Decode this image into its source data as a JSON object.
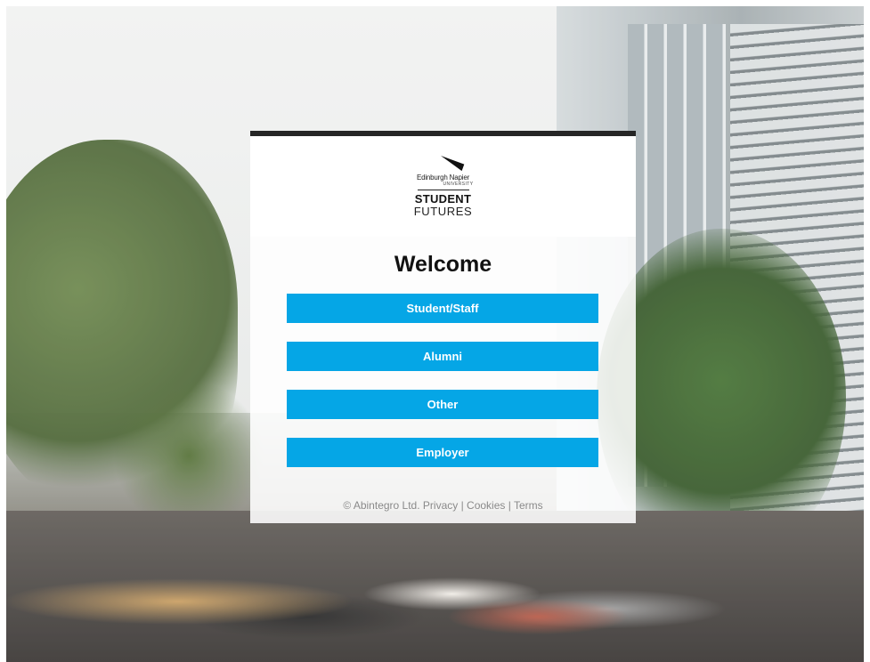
{
  "background": {
    "description_icon": "campus-photo-background"
  },
  "card": {
    "accent_color": "#262626",
    "logo": {
      "university_name": "Edinburgh Napier",
      "university_sub": "UNIVERSITY",
      "line1": "STUDENT",
      "line2": "FUTURES"
    },
    "title": "Welcome",
    "button_color": "#05a6e6",
    "buttons": [
      {
        "label": "Student/Staff"
      },
      {
        "label": "Alumni"
      },
      {
        "label": "Other"
      },
      {
        "label": "Employer"
      }
    ],
    "footer": {
      "copyright": "© Abintegro Ltd.",
      "privacy": "Privacy",
      "separator1": " | ",
      "cookies": "Cookies",
      "separator2": " | ",
      "terms": "Terms"
    }
  }
}
